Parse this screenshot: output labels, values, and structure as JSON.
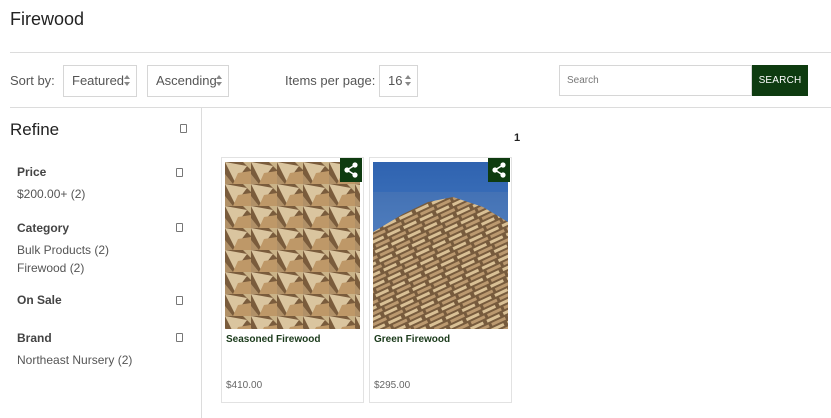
{
  "page": {
    "title": "Firewood"
  },
  "toolbar": {
    "sort_label": "Sort by:",
    "sort_value": "Featured",
    "order_value": "Ascending",
    "per_page_label": "Items per page:",
    "per_page_value": "16",
    "search_placeholder": "Search",
    "search_button": "SEARCH"
  },
  "refine": {
    "title": "Refine",
    "facets": [
      {
        "name": "Price",
        "values": [
          "$200.00+ (2)"
        ]
      },
      {
        "name": "Category",
        "values": [
          "Bulk Products (2)",
          "Firewood (2)"
        ]
      },
      {
        "name": "On Sale",
        "values": []
      },
      {
        "name": "Brand",
        "values": [
          "Northeast Nursery (2)"
        ]
      }
    ]
  },
  "pagination": {
    "current": "1"
  },
  "products": [
    {
      "name": "Seasoned Firewood",
      "price": "$410.00",
      "share_icon": "share-icon"
    },
    {
      "name": "Green Firewood",
      "price": "$295.00",
      "share_icon": "share-icon"
    }
  ],
  "colors": {
    "accent": "#0e3b10",
    "border": "#dcdcdc",
    "sky": "#2a5ea8"
  }
}
